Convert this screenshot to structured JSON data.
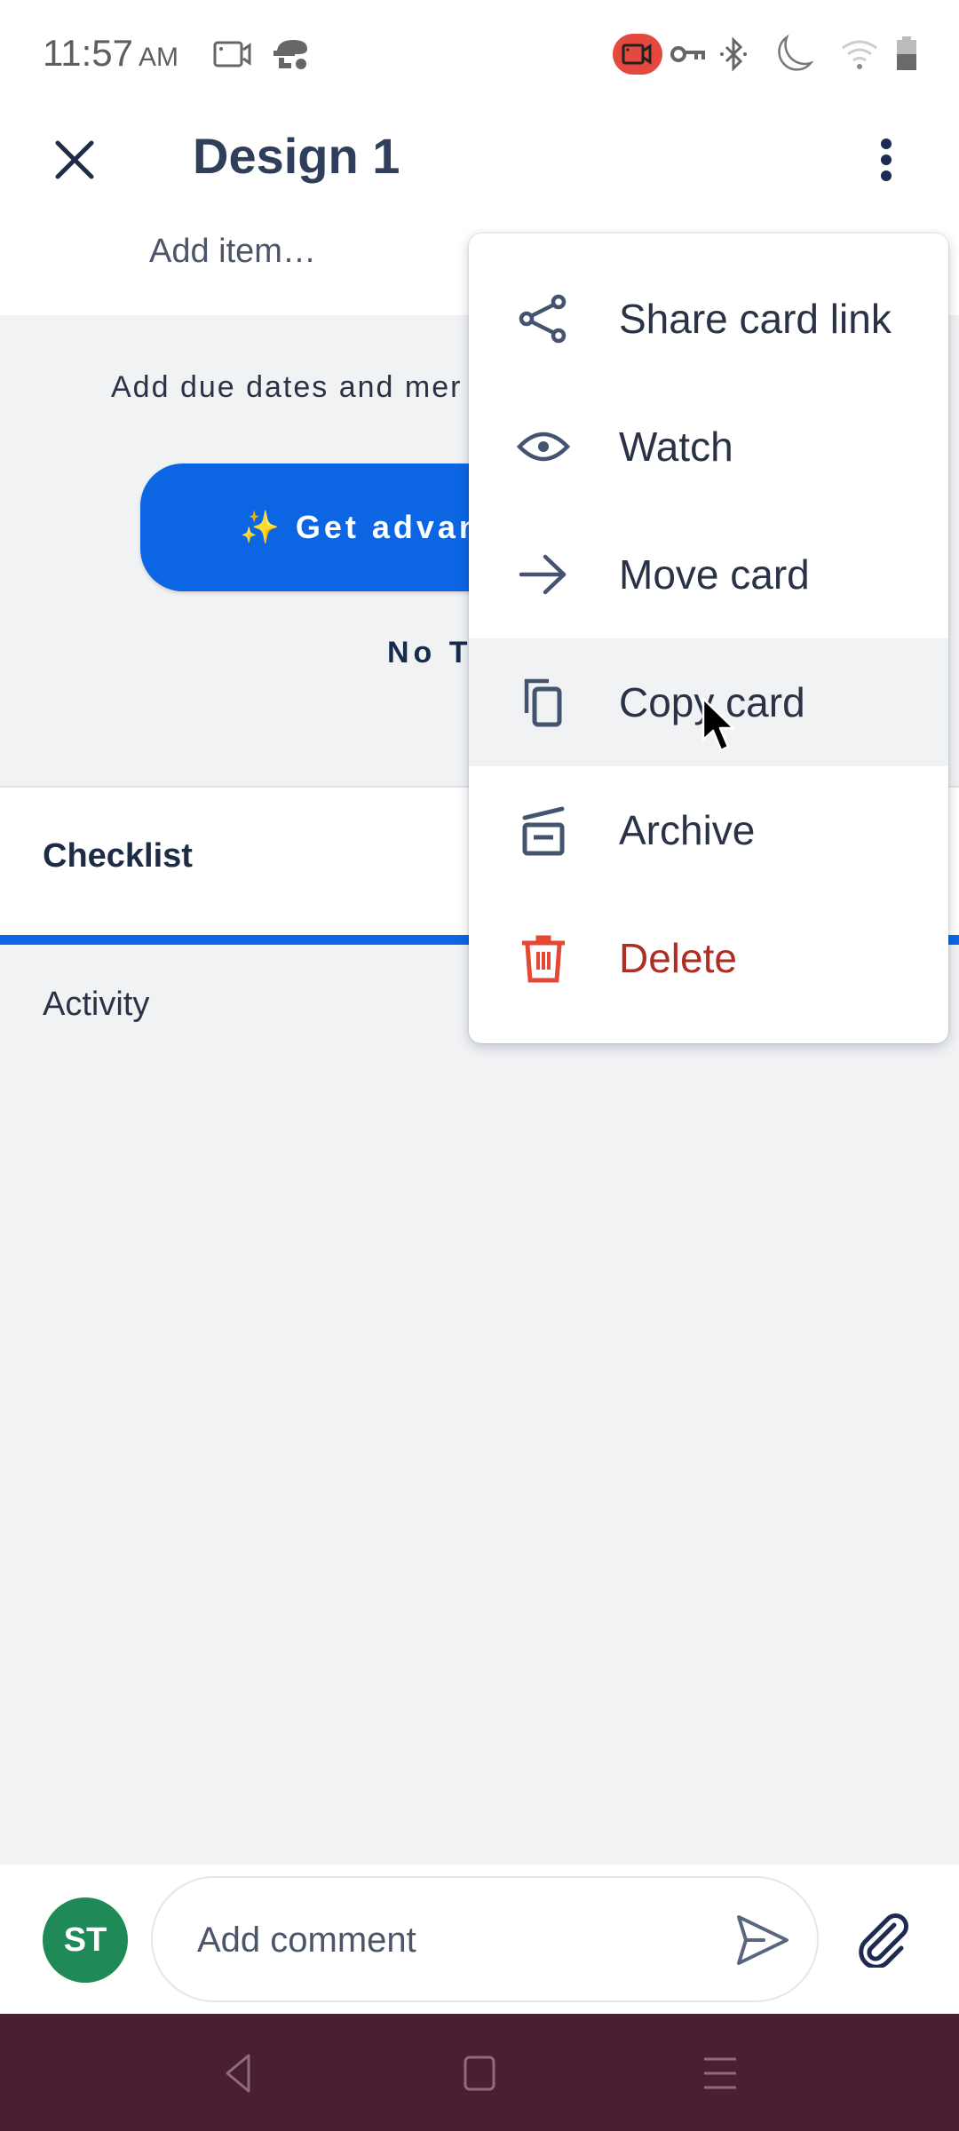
{
  "status_bar": {
    "time": "11:57",
    "ampm": "AM",
    "left_icons": [
      "screen-record-icon",
      "incognito-icon"
    ],
    "right_icons": [
      "screen-recording-active-icon",
      "vpn-key-icon",
      "bluetooth-icon",
      "do-not-disturb-moon-icon",
      "wifi-icon",
      "battery-icon"
    ],
    "recording_badge_color": "#e5483f"
  },
  "header": {
    "close_icon": "close-icon",
    "title": "Design 1",
    "more_icon": "more-vertical-icon"
  },
  "checklist_input": {
    "placeholder": "Add item…"
  },
  "upsell": {
    "text": "Add due dates and mer",
    "button_label": "✨ Get advan",
    "secondary_label": "No T",
    "accent_color": "#0c66e4"
  },
  "checklist": {
    "title": "Checklist",
    "progress_percent": 100
  },
  "activity": {
    "title": "Activity"
  },
  "menu": {
    "items": [
      {
        "label": "Share card link",
        "icon": "share-icon"
      },
      {
        "label": "Watch",
        "icon": "eye-icon"
      },
      {
        "label": "Move card",
        "icon": "arrow-right-icon"
      },
      {
        "label": "Copy card",
        "icon": "copy-icon",
        "highlighted": true
      },
      {
        "label": "Archive",
        "icon": "archive-icon"
      },
      {
        "label": "Delete",
        "icon": "trash-icon",
        "danger": true
      }
    ],
    "danger_color": "#c9372c"
  },
  "comment_bar": {
    "avatar_initials": "ST",
    "avatar_color": "#1f8a57",
    "placeholder": "Add comment",
    "send_icon": "send-icon",
    "attach_icon": "paperclip-icon"
  },
  "nav_bar": {
    "buttons": [
      "back-icon",
      "home-icon",
      "recents-menu-icon"
    ],
    "color": "#4a1f33"
  }
}
